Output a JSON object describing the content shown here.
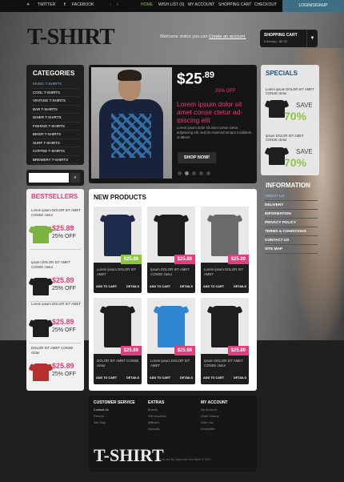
{
  "colors": {
    "accent_pink": "#e43d7a",
    "accent_green": "#8cc63f",
    "link_blue": "#8fb3d9"
  },
  "topbar": {
    "twitter": "TWITTER",
    "facebook": "FACEBOOK",
    "nav": [
      "HOME",
      "WISH LIST (0)",
      "MY ACCOUNT",
      "SHOPPING CART",
      "CHECKOUT"
    ],
    "login": "LOGIN/SIGNUP"
  },
  "header": {
    "logo": "T-SHIRT",
    "welcome": "Welcome visitor you can ",
    "account_link": "Create an account.",
    "cart_title": "SHOPPING CART",
    "cart_summary": "0 item(s) - $0.00"
  },
  "categories": {
    "title": "CATEGORIES",
    "items": [
      "MUSIC T-SHIRTS",
      "COOL T-SHIRTS",
      "VINTAGE T-SHIRTS",
      "BAR T-SHIRTS",
      "DINER T-SHIRTS",
      "FISHING T-SHIRTS",
      "BIKER T-SHIRTS",
      "SURF T-SHIRTS",
      "COFFEE T-SHIRTS",
      "BREWERY T-SHIRTS"
    ]
  },
  "slider": {
    "price_main": "$25",
    "price_cents": ".89",
    "discount": "25% OFF",
    "title": "Lorem ipsum dolor sit amet conse ctetur ad-ipiscing elit",
    "text": "Lorem ipsum dolor sit amet conse ctetur adipisicing elit, sed do eiusmod tempor incididunt ut labore",
    "button": "SHOP NOW!",
    "slides": 5,
    "active_slide": 1
  },
  "specials": {
    "title": "SPECIALS",
    "items": [
      {
        "name": "Lorem ipsum DOLOR SIT AMET CONSE ctetur",
        "save": "SAVE",
        "pct": "70%"
      },
      {
        "name": "Ipsum DOLOR SIT AMET CONSE ctetur",
        "save": "SAVE",
        "pct": "70%"
      }
    ]
  },
  "information": {
    "title": "INFORMATION",
    "items": [
      "ABOUT US",
      "DELIVERY",
      "INFORMATION",
      "PRIVACY POLICY",
      "TERMS & CONDITIONS",
      "CONTACT US",
      "SITE MAP"
    ]
  },
  "bestsellers": {
    "title": "BESTSELLERS",
    "items": [
      {
        "name": "Lorem ipsum DOLOR SIT AMET CONSE ctetur",
        "price": "$25.89",
        "off": "25% OFF"
      },
      {
        "name": "Ipsum DOLOR SIT AMET CONSE ctetur",
        "price": "$25.89",
        "off": "25% OFF"
      },
      {
        "name": "Lorem ipsum DOLOR SIT AMET",
        "price": "$25.89",
        "off": "25% OFF"
      },
      {
        "name": "DOLOR SIT AMET CONSE ctetur",
        "price": "$25.89",
        "off": "25% OFF"
      }
    ]
  },
  "new_products": {
    "title": "NEW PRODUCTS",
    "add": "ADD TO CART",
    "details": "DETAILS",
    "items": [
      {
        "name": "Lorem ipsum DOLOR SIT AMET",
        "price": "$25.89",
        "shirt": "#1f2b4d",
        "tag": "#8cc63f"
      },
      {
        "name": "Ipsum DOLOR SIT AMET CONSE ctetur",
        "price": "$25.89",
        "shirt": "#1e1e1e",
        "tag": "#e43d7a"
      },
      {
        "name": "Lorem ipsum DOLOR SIT AMET",
        "price": "$25.89",
        "shirt": "#6a6a6a",
        "tag": "#e43d7a"
      },
      {
        "name": "DOLOR SIT AMET CONSE ctetur",
        "price": "$25.89",
        "shirt": "#1e1e1e",
        "tag": "#e43d7a"
      },
      {
        "name": "Lorem ipsum DOLOR SIT AMET",
        "price": "$25.89",
        "shirt": "#2f86d1",
        "tag": "#e43d7a"
      },
      {
        "name": "Ipsum DOLOR SIT AMET CONSE ctetur",
        "price": "$25.89",
        "shirt": "#1e1e1e",
        "tag": "#e43d7a"
      }
    ]
  },
  "footer": {
    "cols": [
      {
        "title": "CUSTOMER SERVICE",
        "items": [
          "Contact Us",
          "Returns",
          "Site Map"
        ]
      },
      {
        "title": "EXTRAS",
        "items": [
          "Brands",
          "Gift Vouchers",
          "Affiliates",
          "Specials"
        ]
      },
      {
        "title": "MY ACCOUNT",
        "items": [
          "My Account",
          "Order History",
          "Wish List",
          "Newsletter"
        ]
      }
    ],
    "logo": "T-SHIRT",
    "copy": "Powered By OpenCart Your Store © 2012"
  }
}
